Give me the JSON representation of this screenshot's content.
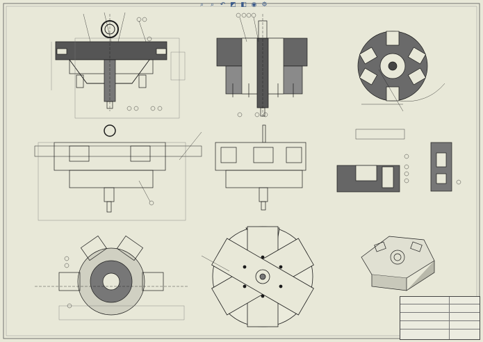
{
  "toolbar": {
    "buttons": [
      {
        "name": "zoom-to-fit-icon",
        "glyph": "⌕"
      },
      {
        "name": "zoom-area-icon",
        "glyph": "⌕"
      },
      {
        "name": "previous-view-icon",
        "glyph": "↶"
      },
      {
        "name": "section-view-icon",
        "glyph": "◩"
      },
      {
        "name": "display-style-icon",
        "glyph": "◧"
      },
      {
        "name": "hide-show-icon",
        "glyph": "◉"
      },
      {
        "name": "view-settings-icon",
        "glyph": "⚙"
      }
    ]
  },
  "colors": {
    "paper": "#e8e8d8",
    "ink": "#1a1a1a",
    "hatch_fill": "#555555",
    "dimension": "#5a5a5a",
    "toolbar_icon": "#3a5a8a"
  },
  "title_block": {
    "rows": [
      "",
      "",
      "",
      "",
      ""
    ]
  }
}
